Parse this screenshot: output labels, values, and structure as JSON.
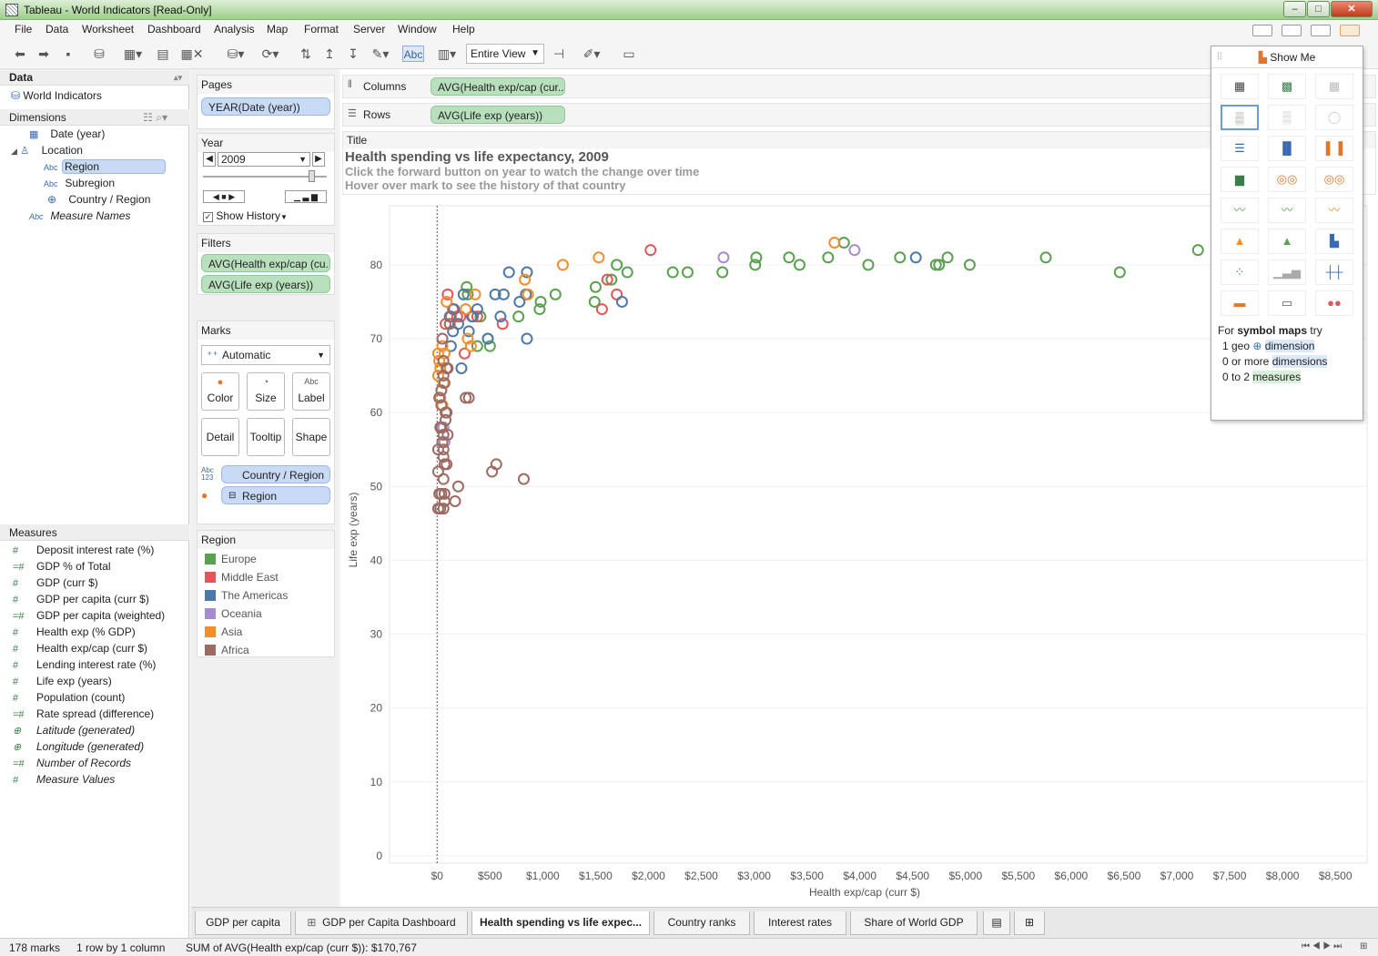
{
  "window": {
    "title": "Tableau - World Indicators [Read-Only]",
    "minimize": "–",
    "maximize": "□",
    "close": "✕"
  },
  "menu": [
    "File",
    "Data",
    "Worksheet",
    "Dashboard",
    "Analysis",
    "Map",
    "Format",
    "Server",
    "Window",
    "Help"
  ],
  "toolbar": {
    "label_button": "Abc",
    "fit_select": "Entire View"
  },
  "data_pane": {
    "header": "Data",
    "datasource": "World Indicators",
    "dimensions_header": "Dimensions",
    "dimensions": [
      {
        "label": "Date (year)",
        "icon": "calendar-icon"
      },
      {
        "label": "Location",
        "icon": "hierarchy-icon"
      },
      {
        "label": "Region",
        "icon": "abc-icon"
      },
      {
        "label": "Subregion",
        "icon": "abc-icon"
      },
      {
        "label": "Country / Region",
        "icon": "globe-icon"
      },
      {
        "label": "Measure Names",
        "icon": "abc-icon"
      }
    ],
    "measures_header": "Measures",
    "measures": [
      "Deposit interest rate (%)",
      "GDP % of Total",
      "GDP (curr $)",
      "GDP per capita (curr $)",
      "GDP per capita (weighted)",
      "Health exp (% GDP)",
      "Health exp/cap (curr $)",
      "Lending interest rate (%)",
      "Life exp (years)",
      "Population (count)",
      "Rate spread (difference)",
      "Latitude (generated)",
      "Longitude (generated)",
      "Number of Records",
      "Measure Values"
    ],
    "measure_icons": [
      "#",
      "=#",
      "#",
      "#",
      "=#",
      "#",
      "#",
      "#",
      "#",
      "#",
      "=#",
      "⊕",
      "⊕",
      "=#",
      "#"
    ]
  },
  "pages": {
    "header": "Pages",
    "pill": "YEAR(Date (year))"
  },
  "year": {
    "header": "Year",
    "value": "2009",
    "show_history": "Show History"
  },
  "filters": {
    "header": "Filters",
    "pills": [
      "AVG(Health exp/cap (cu..",
      "AVG(Life exp (years))"
    ]
  },
  "marks": {
    "header": "Marks",
    "type": "Automatic",
    "buttons": [
      "Color",
      "Size",
      "Label",
      "Detail",
      "Tooltip",
      "Shape"
    ],
    "fields": [
      "Country / Region",
      "Region"
    ]
  },
  "legend": {
    "header": "Region",
    "items": [
      {
        "label": "Europe",
        "color": "#59a14f"
      },
      {
        "label": "Middle East",
        "color": "#e15759"
      },
      {
        "label": "The Americas",
        "color": "#4e79a7"
      },
      {
        "label": "Oceania",
        "color": "#a58cd0"
      },
      {
        "label": "Asia",
        "color": "#f28e2b"
      },
      {
        "label": "Africa",
        "color": "#9c6b63"
      }
    ]
  },
  "shelves": {
    "columns_label": "Columns",
    "columns_pill": "AVG(Health exp/cap (cur..",
    "rows_label": "Rows",
    "rows_pill": "AVG(Life exp (years))"
  },
  "title_card": {
    "label": "Title",
    "title": "Health spending vs life expectancy, 2009",
    "line1": "Click the forward button on year to watch the change over time",
    "line2": "Hover over mark to see the history of that country"
  },
  "chart_data": {
    "type": "scatter",
    "xlabel": "Health exp/cap (curr $)",
    "ylabel": "Life exp (years)",
    "xlim": [
      -450,
      8800
    ],
    "ylim": [
      -1,
      88
    ],
    "xticks": [
      "$0",
      "$500",
      "$1,000",
      "$1,500",
      "$2,000",
      "$2,500",
      "$3,000",
      "$3,500",
      "$4,000",
      "$4,500",
      "$5,000",
      "$5,500",
      "$6,000",
      "$6,500",
      "$7,000",
      "$7,500",
      "$8,000",
      "$8,500"
    ],
    "yticks": [
      0,
      10,
      20,
      30,
      40,
      50,
      60,
      70,
      80
    ],
    "series": [
      {
        "name": "Europe",
        "color": "#59a14f",
        "points": [
          [
            2700,
            79
          ],
          [
            3020,
            81
          ],
          [
            3010,
            80
          ],
          [
            3330,
            81
          ],
          [
            3430,
            80
          ],
          [
            3700,
            81
          ],
          [
            3850,
            83
          ],
          [
            4080,
            80
          ],
          [
            4380,
            81
          ],
          [
            4720,
            80
          ],
          [
            4750,
            80
          ],
          [
            4830,
            81
          ],
          [
            5040,
            80
          ],
          [
            5760,
            81
          ],
          [
            6460,
            79
          ],
          [
            7200,
            82
          ],
          [
            1700,
            80
          ],
          [
            1800,
            79
          ],
          [
            1650,
            78
          ],
          [
            1500,
            77
          ],
          [
            1490,
            75
          ],
          [
            1120,
            76
          ],
          [
            980,
            75
          ],
          [
            970,
            74
          ],
          [
            770,
            73
          ],
          [
            500,
            69
          ],
          [
            480,
            70
          ],
          [
            380,
            69
          ],
          [
            410,
            73
          ],
          [
            280,
            77
          ],
          [
            290,
            76
          ],
          [
            2230,
            79
          ],
          [
            2370,
            79
          ]
        ]
      },
      {
        "name": "Middle East",
        "color": "#e15759",
        "points": [
          [
            2020,
            82
          ],
          [
            1700,
            76
          ],
          [
            1610,
            78
          ],
          [
            1560,
            74
          ],
          [
            620,
            72
          ],
          [
            380,
            73
          ],
          [
            340,
            73
          ],
          [
            100,
            76
          ],
          [
            190,
            73
          ],
          [
            220,
            73
          ],
          [
            260,
            68
          ],
          [
            80,
            72
          ],
          [
            150,
            74
          ]
        ]
      },
      {
        "name": "The Americas",
        "color": "#4e79a7",
        "points": [
          [
            4530,
            81
          ],
          [
            1750,
            75
          ],
          [
            850,
            79
          ],
          [
            680,
            79
          ],
          [
            840,
            76
          ],
          [
            780,
            75
          ],
          [
            630,
            76
          ],
          [
            550,
            76
          ],
          [
            480,
            70
          ],
          [
            850,
            70
          ],
          [
            250,
            76
          ],
          [
            330,
            73
          ],
          [
            300,
            71
          ],
          [
            200,
            72
          ],
          [
            160,
            74
          ],
          [
            150,
            71
          ],
          [
            130,
            69
          ],
          [
            230,
            66
          ],
          [
            120,
            73
          ],
          [
            380,
            74
          ],
          [
            600,
            73
          ]
        ]
      },
      {
        "name": "Oceania",
        "color": "#a58cd0",
        "points": [
          [
            3950,
            82
          ],
          [
            2710,
            81
          ],
          [
            60,
            58
          ],
          [
            70,
            56
          ]
        ]
      },
      {
        "name": "Asia",
        "color": "#f28e2b",
        "points": [
          [
            3760,
            83
          ],
          [
            1530,
            81
          ],
          [
            1190,
            80
          ],
          [
            830,
            78
          ],
          [
            860,
            76
          ],
          [
            360,
            76
          ],
          [
            270,
            74
          ],
          [
            290,
            70
          ],
          [
            320,
            69
          ],
          [
            50,
            69
          ],
          [
            70,
            68
          ],
          [
            20,
            67
          ],
          [
            30,
            66
          ],
          [
            10,
            65
          ],
          [
            60,
            64
          ],
          [
            40,
            63
          ],
          [
            30,
            62
          ],
          [
            50,
            61
          ],
          [
            90,
            75
          ],
          [
            10,
            68
          ]
        ]
      },
      {
        "name": "Africa",
        "color": "#9c6b63",
        "points": [
          [
            820,
            51
          ],
          [
            560,
            53
          ],
          [
            520,
            52
          ],
          [
            270,
            62
          ],
          [
            300,
            62
          ],
          [
            200,
            50
          ],
          [
            170,
            48
          ],
          [
            10,
            47
          ],
          [
            30,
            47
          ],
          [
            60,
            47
          ],
          [
            70,
            48
          ],
          [
            20,
            49
          ],
          [
            40,
            49
          ],
          [
            60,
            51
          ],
          [
            70,
            53
          ],
          [
            60,
            54
          ],
          [
            60,
            55
          ],
          [
            50,
            56
          ],
          [
            60,
            57
          ],
          [
            40,
            58
          ],
          [
            80,
            59
          ],
          [
            90,
            60
          ],
          [
            40,
            61
          ],
          [
            20,
            62
          ],
          [
            40,
            63
          ],
          [
            70,
            64
          ],
          [
            60,
            65
          ],
          [
            100,
            66
          ],
          [
            60,
            67
          ],
          [
            50,
            70
          ],
          [
            120,
            72
          ],
          [
            130,
            73
          ],
          [
            80,
            60
          ],
          [
            100,
            57
          ],
          [
            90,
            53
          ],
          [
            70,
            49
          ],
          [
            10,
            52
          ],
          [
            30,
            58
          ],
          [
            90,
            66
          ],
          [
            10,
            55
          ]
        ]
      }
    ]
  },
  "tabs": [
    "GDP per capita",
    "GDP per Capita Dashboard",
    "Health spending vs life expec...",
    "Country ranks",
    "Interest rates",
    "Share of World GDP"
  ],
  "status": {
    "marks": "178 marks",
    "layout": "1 row by 1 column",
    "sum": "SUM of AVG(Health exp/cap (curr $)): $170,767"
  },
  "showme": {
    "header": "Show Me",
    "hint_prefix": "For",
    "hint_bold": "symbol maps",
    "hint_suffix": "try",
    "req1_pre": "1 geo",
    "req1": "dimension",
    "req2_pre": "0 or more",
    "req2": "dimensions",
    "req3_pre": "0 to 2",
    "req3": "measures"
  }
}
